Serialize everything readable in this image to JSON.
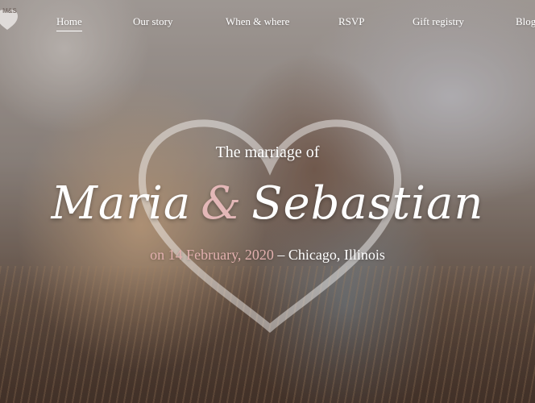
{
  "nav": {
    "logo_text": "M&S",
    "items": [
      {
        "label": "Home",
        "active": true
      },
      {
        "label": "Our story"
      },
      {
        "label": "When & where"
      },
      {
        "label": "RSVP"
      },
      {
        "label": "Gift registry"
      },
      {
        "label": "Blog"
      }
    ]
  },
  "hero": {
    "subtitle": "The marriage of",
    "name_one": "Maria",
    "ampersand": "&",
    "name_two": "Sebastian",
    "date_text": "on 14 February, 2020",
    "separator": " – ",
    "place_text": "Chicago, Illinois"
  },
  "colors": {
    "accent": "#e2b0ae",
    "text": "#ffffff"
  }
}
